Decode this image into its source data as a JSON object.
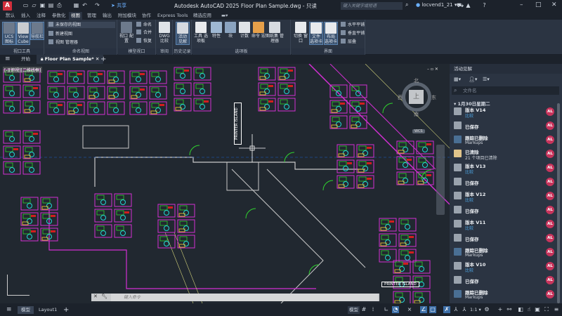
{
  "titlebar": {
    "app_letter": "A",
    "share": "共享",
    "title": "Autodesk AutoCAD 2025    Floor Plan Sample.dwg - 只读",
    "search_placeholder": "键入关键字或短语",
    "user": "locvend1_21"
  },
  "ribbon_tabs": [
    "默认",
    "插入",
    "注释",
    "参数化",
    "视图",
    "管理",
    "输出",
    "附加模块",
    "协作",
    "Express Tools",
    "精选应用"
  ],
  "active_tab": "视图",
  "ribbon": {
    "viewport_tools": {
      "title": "视口工具",
      "ucs": "UCS 图标",
      "viewcube": "View Cube",
      "navbar": "导航栏"
    },
    "named_views": {
      "title": "命名视图",
      "dropdown": "未保存的视图",
      "new": "新建视图",
      "manager": "视图 管理器"
    },
    "model_viewports": {
      "title": "模型视口",
      "config": "视口 配置",
      "name": "命名",
      "join": "合并",
      "restore": "恢复"
    },
    "review": {
      "title": "审阅",
      "dwg_compare": "DWG 比较"
    },
    "history": {
      "title": "历史记录",
      "activity": "活动 见解"
    },
    "palettes": {
      "title": "选项板",
      "tool": "工具 选项板",
      "props": "特性",
      "block": "块",
      "count": "计数",
      "cmd": "命令 宏",
      "sheetset": "图纸集 管理器"
    },
    "interface": {
      "title": "界面",
      "switch": "切换 窗口",
      "file_tabs": "文件 选项卡",
      "layout_tabs": "布局 选项卡",
      "tile_h": "水平平铺",
      "tile_v": "垂直平铺",
      "cascade": "层叠"
    }
  },
  "doc_tabs": {
    "start": "开始",
    "file": "Floor Plan Sample*"
  },
  "viewport": {
    "label": "[-][俯视][二维线框]",
    "compass": {
      "n": "北",
      "s": "南",
      "e": "东",
      "w": "西",
      "top": "上"
    },
    "wcs": "WCS",
    "printer_v": "PRINTER ISLAND",
    "printer_h": "PRINTER ISLAND"
  },
  "command": {
    "placeholder": "键入命令"
  },
  "activity_panel": {
    "title": "活动见解",
    "search_placeholder": "文件名",
    "date_group": "1月30日星期二",
    "items": [
      {
        "t1": "版本 V14",
        "t2": "比较",
        "link": true,
        "icon": "version-save-icon",
        "avatar": "AL"
      },
      {
        "t1": "已保存",
        "t2": "",
        "icon": "save-icon",
        "avatar": "AL"
      },
      {
        "t1": "跟踪已删除",
        "t2": "Markups",
        "icon": "markup-delete-icon",
        "avatar": "AL"
      },
      {
        "t1": "已清除",
        "t2": "21 个项目已清除",
        "icon": "purge-icon",
        "avatar": "AL"
      },
      {
        "t1": "版本 V13",
        "t2": "比较",
        "link": true,
        "icon": "version-save-icon",
        "avatar": "AL"
      },
      {
        "t1": "已保存",
        "t2": "",
        "icon": "save-icon",
        "avatar": "AL"
      },
      {
        "t1": "版本 V12",
        "t2": "比较",
        "link": true,
        "icon": "version-save-icon",
        "avatar": "AL"
      },
      {
        "t1": "已保存",
        "t2": "",
        "icon": "save-icon",
        "avatar": "AL"
      },
      {
        "t1": "版本 V11",
        "t2": "比较",
        "link": true,
        "icon": "version-save-icon",
        "avatar": "AL"
      },
      {
        "t1": "已保存",
        "t2": "",
        "icon": "save-icon",
        "avatar": "AL"
      },
      {
        "t1": "跟踪已删除",
        "t2": "Markups",
        "icon": "markup-delete-icon",
        "avatar": "AL"
      },
      {
        "t1": "版本 V10",
        "t2": "比较",
        "link": true,
        "icon": "version-save-icon",
        "avatar": "AL"
      },
      {
        "t1": "已保存",
        "t2": "",
        "icon": "save-icon",
        "avatar": "AL"
      },
      {
        "t1": "跟踪已删除",
        "t2": "Markups",
        "icon": "markup-delete-icon",
        "avatar": "AL"
      }
    ]
  },
  "statusbar": {
    "model_tab": "模型",
    "layout_tab": "Layout1",
    "model_btn": "模型",
    "scale": "1:1"
  },
  "colors": {
    "accent": "#3d6fa8",
    "avatar": "#c8345c",
    "app": "#d32f3c"
  }
}
